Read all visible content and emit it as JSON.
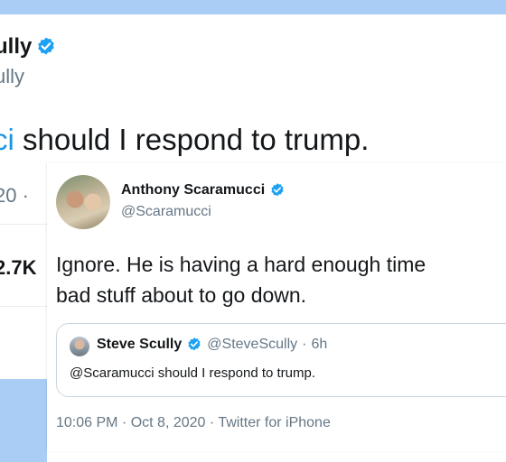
{
  "background_tweet": {
    "name_partial": "ully",
    "handle_partial": "ully",
    "text_mention_partial": "ci",
    "text_rest": " should I respond to trump.",
    "date_partial": "20 ·",
    "stat_partial": "2.7K"
  },
  "reply_tweet": {
    "author_name": "Anthony Scaramucci",
    "author_handle": "@Scaramucci",
    "text_line1": "Ignore. He is having a hard enough time",
    "text_line2": "bad stuff about to go down.",
    "timestamp": "10:06 PM · Oct 8, 2020 · Twitter for iPhone"
  },
  "quoted_tweet": {
    "author_name": "Steve Scully",
    "author_handle": "@SteveScully",
    "separator": "·",
    "time": "6h",
    "text": "@Scaramucci should I respond to trump."
  },
  "colors": {
    "accent": "#1b95e0",
    "verified": "#1da1f2",
    "secondary_text": "#657786",
    "background": "#a9cdf5"
  },
  "icons": {
    "verified": "verified-badge-icon"
  }
}
